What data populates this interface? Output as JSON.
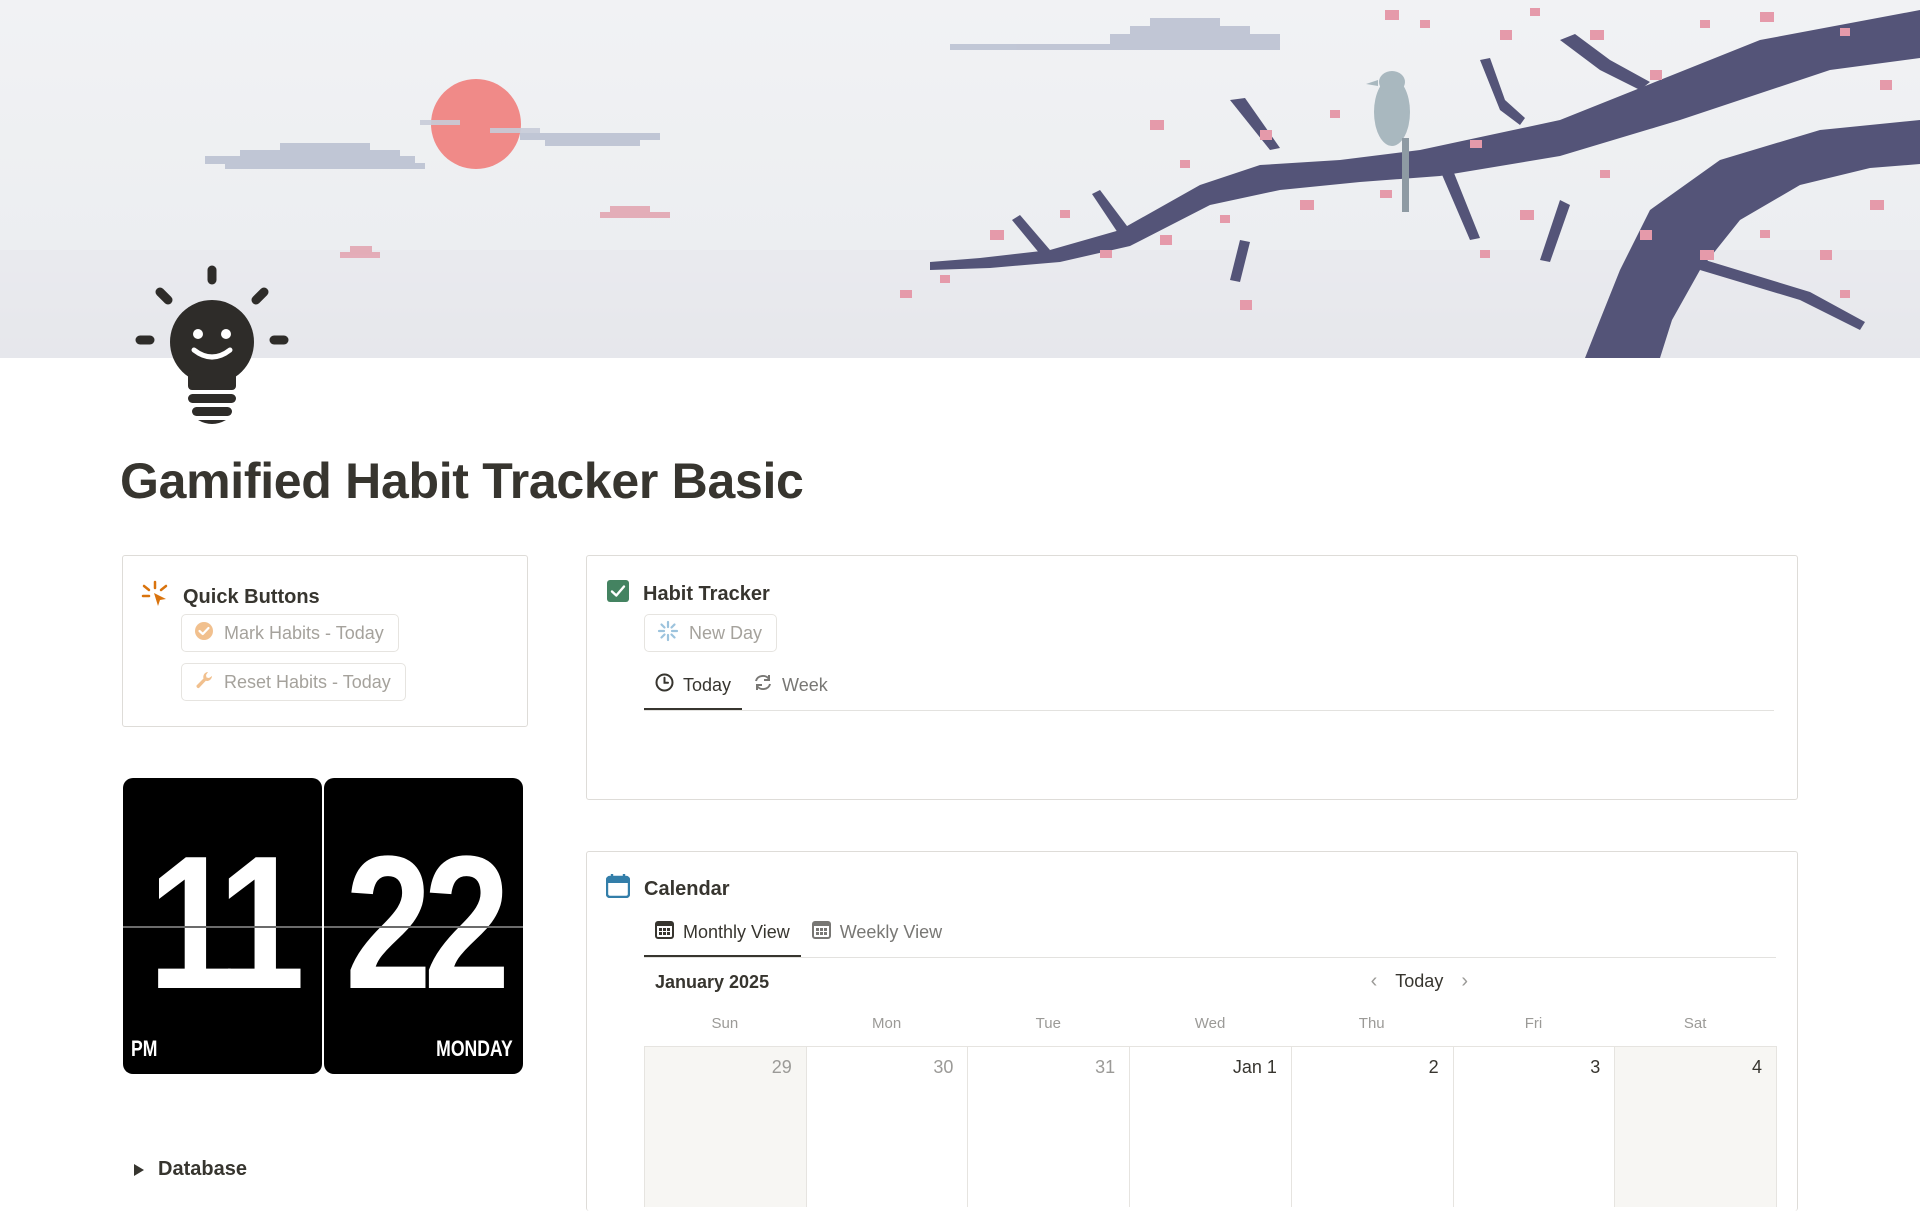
{
  "page": {
    "title": "Gamified Habit Tracker Basic"
  },
  "quick_buttons": {
    "title": "Quick Buttons",
    "buttons": [
      {
        "label": "Mark Habits - Today",
        "icon": "check-circle-icon"
      },
      {
        "label": "Reset Habits - Today",
        "icon": "wrench-icon"
      }
    ]
  },
  "habit_tracker": {
    "title": "Habit Tracker",
    "new_day_button": "New Day",
    "tabs": [
      {
        "label": "Today",
        "icon": "clock-icon",
        "active": true
      },
      {
        "label": "Week",
        "icon": "refresh-icon",
        "active": false
      }
    ]
  },
  "clock": {
    "hour": "11",
    "minute": "22",
    "period": "PM",
    "weekday": "MONDAY"
  },
  "calendar": {
    "title": "Calendar",
    "tabs": [
      {
        "label": "Monthly View",
        "icon": "calendar-grid-icon",
        "active": true
      },
      {
        "label": "Weekly View",
        "icon": "calendar-grid-icon",
        "active": false
      }
    ],
    "month": "January 2025",
    "today_button": "Today",
    "weekdays": [
      "Sun",
      "Mon",
      "Tue",
      "Wed",
      "Thu",
      "Fri",
      "Sat"
    ],
    "days": [
      "29",
      "30",
      "31",
      "Jan 1",
      "2",
      "3",
      "4"
    ]
  },
  "database_toggle": {
    "label": "Database"
  },
  "colors": {
    "text": "#37352f",
    "muted_text": "#9b9a97",
    "accent_orange": "#d9730d",
    "accent_green": "#448361",
    "accent_blue": "#337ea9",
    "sun": "#f08a88",
    "branch": "#545478",
    "blossom": "#e59aaa"
  }
}
